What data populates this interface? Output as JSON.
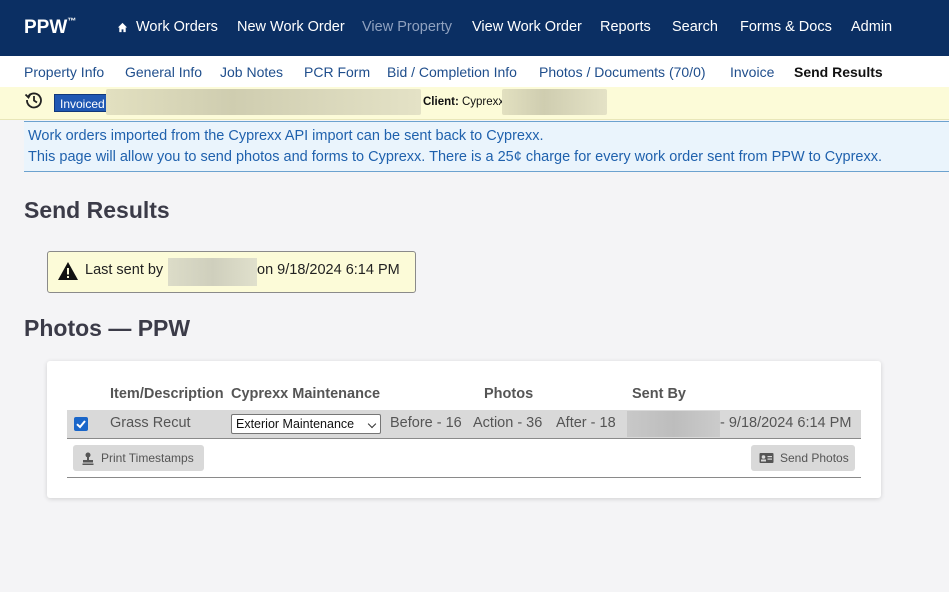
{
  "brand": "PPW",
  "brand_tm": "™",
  "nav": {
    "work_orders": "Work Orders",
    "new_work_order": "New Work Order",
    "view_property": "View Property",
    "view_work_order": "View Work Order",
    "reports": "Reports",
    "search": "Search",
    "forms_docs": "Forms & Docs",
    "admin": "Admin"
  },
  "tabs": {
    "property_info": "Property Info",
    "general_info": "General Info",
    "job_notes": "Job Notes",
    "pcr_form": "PCR Form",
    "bid_completion": "Bid / Completion Info",
    "photos_docs": "Photos / Documents (70/0)",
    "invoice": "Invoice",
    "send_results": "Send Results"
  },
  "status": {
    "badge": "Invoiced",
    "client_label": "Client:",
    "client_value": "Cyprexx"
  },
  "info": {
    "line1": "Work orders imported from the Cyprexx API import can be sent back to Cyprexx.",
    "line2": "This page will allow you to send photos and forms to Cyprexx. There is a 25¢ charge for every work order sent from PPW to Cyprexx."
  },
  "page_title": "Send Results",
  "last_sent": {
    "prefix": "Last sent by",
    "suffix": "on 9/18/2024 6:14 PM"
  },
  "section_title": "Photos — PPW",
  "table": {
    "headers": {
      "item": "Item/Description",
      "maintenance": "Cyprexx Maintenance",
      "photos": "Photos",
      "sent_by": "Sent By"
    },
    "row": {
      "item": "Grass Recut",
      "maintenance": "Exterior Maintenance",
      "before": "Before - 16",
      "action": "Action - 36",
      "after": "After - 18",
      "sent_date": "- 9/18/2024 6:14 PM",
      "checked": true
    }
  },
  "buttons": {
    "print_timestamps": "Print Timestamps",
    "send_photos": "Send Photos"
  },
  "colors": {
    "nav_bg": "#0b2f63",
    "badge": "#1f58b3",
    "info_text": "#1f61ad",
    "status_bg": "#fcfbd8"
  }
}
